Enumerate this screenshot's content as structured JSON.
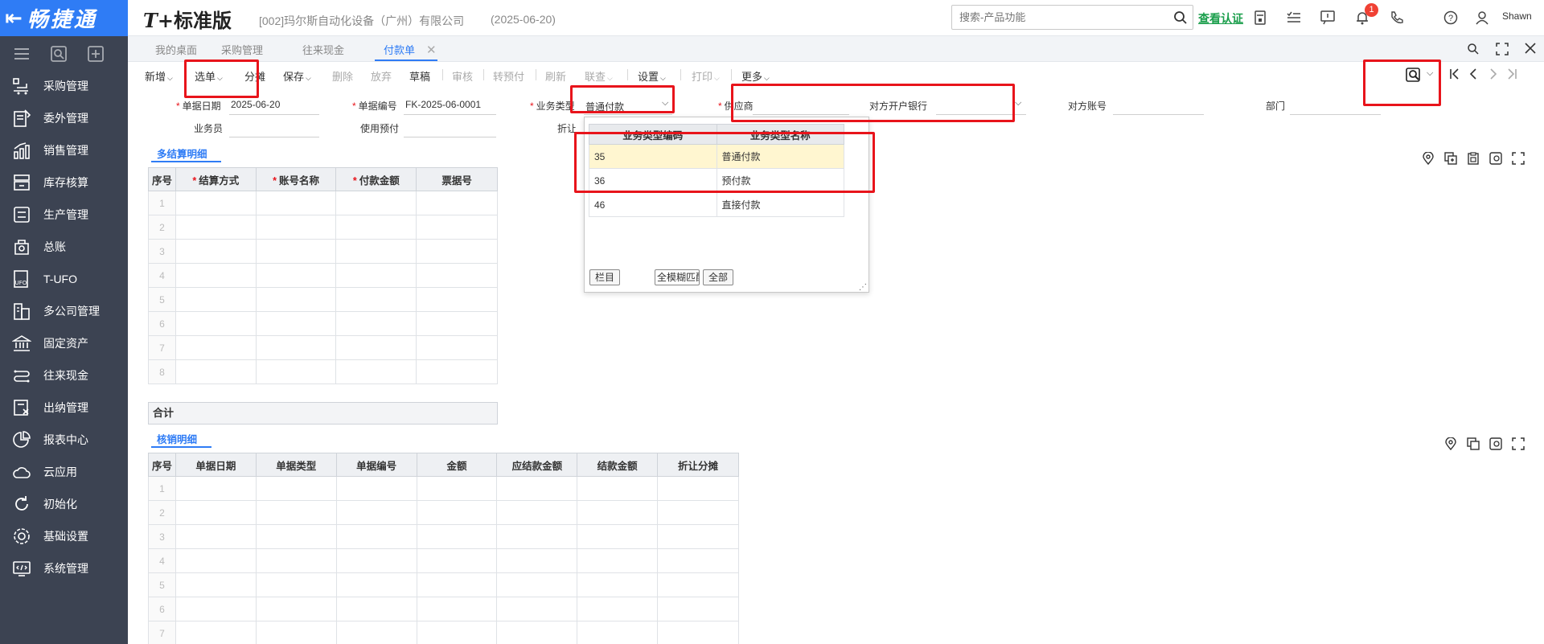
{
  "app": {
    "brand": "畅捷通",
    "product_prefix": "T+",
    "product_name": "标准版",
    "company": "[002]玛尔斯自动化设备（广州）有限公司",
    "date": "(2025-06-20)",
    "search_placeholder": "搜索-产品功能",
    "verify_label": "查看认证",
    "notification_count": "1",
    "user": "Shawn",
    "accent_color": "#2f7cf5"
  },
  "sidebar": {
    "items": [
      {
        "label": "采购管理",
        "icon": "purchase-icon"
      },
      {
        "label": "委外管理",
        "icon": "outsource-icon"
      },
      {
        "label": "销售管理",
        "icon": "sales-chart-icon"
      },
      {
        "label": "库存核算",
        "icon": "inventory-icon"
      },
      {
        "label": "生产管理",
        "icon": "production-icon"
      },
      {
        "label": "总账",
        "icon": "ledger-icon"
      },
      {
        "label": "T-UFO",
        "icon": "ufo-icon"
      },
      {
        "label": "多公司管理",
        "icon": "multi-company-icon"
      },
      {
        "label": "固定资产",
        "icon": "bank-icon"
      },
      {
        "label": "往来现金",
        "icon": "cash-flow-icon"
      },
      {
        "label": "出纳管理",
        "icon": "cashier-icon"
      },
      {
        "label": "报表中心",
        "icon": "pie-chart-icon"
      },
      {
        "label": "云应用",
        "icon": "cloud-icon"
      },
      {
        "label": "初始化",
        "icon": "refresh-icon"
      },
      {
        "label": "基础设置",
        "icon": "settings-icon"
      },
      {
        "label": "系统管理",
        "icon": "system-icon"
      }
    ]
  },
  "tabs": [
    {
      "label": "我的桌面"
    },
    {
      "label": "采购管理"
    },
    {
      "label": "往来现金"
    },
    {
      "label": "付款单",
      "active": true
    }
  ],
  "toolbar": {
    "new": "新增",
    "select": "选单",
    "split": "分摊",
    "save": "保存",
    "delete": "删除",
    "abandon": "放弃",
    "draft": "草稿",
    "audit": "审核",
    "to_prepay": "转预付",
    "refresh": "刷新",
    "link": "联查",
    "settings": "设置",
    "print": "打印",
    "more": "更多"
  },
  "form": {
    "doc_date_label": "单据日期",
    "doc_date": "2025-06-20",
    "doc_no_label": "单据编号",
    "doc_no": "FK-2025-06-0001",
    "biz_type_label": "业务类型",
    "biz_type": "普通付款",
    "supplier_label": "供应商",
    "bank_label": "对方开户银行",
    "account_label": "对方账号",
    "dept_label": "部门",
    "salesman_label": "业务员",
    "use_prepay_label": "使用预付",
    "discount_label": "折让"
  },
  "settlement": {
    "title": "多结算明细",
    "columns": [
      "序号",
      "结算方式",
      "账号名称",
      "付款金额",
      "票据号"
    ],
    "required": [
      false,
      true,
      true,
      true,
      false
    ],
    "rows": [
      "1",
      "2",
      "3",
      "4",
      "5",
      "6",
      "7",
      "8"
    ],
    "total_label": "合计"
  },
  "writeoff": {
    "title": "核销明细",
    "columns": [
      "序号",
      "单据日期",
      "单据类型",
      "单据编号",
      "金额",
      "应结款金额",
      "结款金额",
      "折让分摊"
    ],
    "rows": [
      "1",
      "2",
      "3",
      "4",
      "5",
      "6",
      "7"
    ]
  },
  "popup": {
    "columns": [
      "业务类型编码",
      "业务类型名称"
    ],
    "rows": [
      {
        "code": "35",
        "name": "普通付款",
        "selected": true
      },
      {
        "code": "36",
        "name": "预付款",
        "selected": false
      },
      {
        "code": "46",
        "name": "直接付款",
        "selected": false
      }
    ],
    "columns_button": "栏目",
    "match_mode": "全模糊匹配",
    "all_button": "全部"
  }
}
